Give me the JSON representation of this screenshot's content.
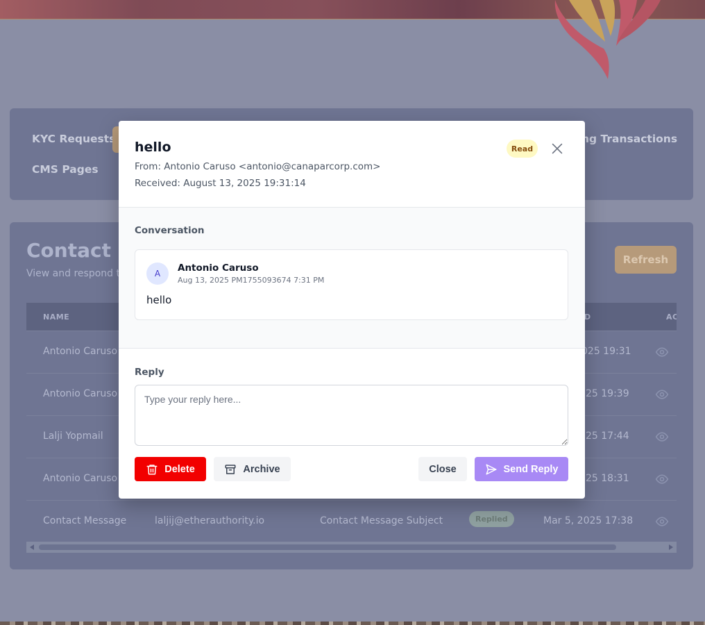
{
  "background": {
    "nav": {
      "items": [
        "KYC Requests",
        "CMS Pages",
        "ng Transactions"
      ]
    },
    "contact_messages": {
      "title_visible": "Contact M",
      "subtitle_visible": "View and respond to",
      "refresh_label": "Refresh",
      "table": {
        "headers": [
          "NAME",
          "D",
          "AC"
        ],
        "rows": [
          {
            "name": "Antonio Caruso",
            "email": "",
            "subject": "",
            "status": "",
            "date": "025 19:31"
          },
          {
            "name": "Antonio Caruso",
            "email": "",
            "subject": "",
            "status": "",
            "date": "25 19:39"
          },
          {
            "name": "Lalji Yopmail",
            "email": "",
            "subject": "",
            "status": "",
            "date": "25 17:44"
          },
          {
            "name": "Antonio Caruso",
            "email": "",
            "subject": "",
            "status": "",
            "date": "25 18:31"
          },
          {
            "name": "Contact Message",
            "email": "laljij@etherauthority.io",
            "subject": "Contact Message Subject",
            "status": "Replied",
            "date": "Mar 5, 2025 17:38"
          }
        ]
      }
    }
  },
  "modal": {
    "subject": "hello",
    "status_badge": "Read",
    "from": "From: Antonio Caruso <antonio@canaparcorp.com>",
    "received": "Received: August 13, 2025 19:31:14",
    "conversation_label": "Conversation",
    "message": {
      "avatar_letter": "A",
      "sender": "Antonio Caruso",
      "sent_at": "Aug 13, 2025 PM1755093674 7:31 PM",
      "body": "hello"
    },
    "reply_label": "Reply",
    "reply_value": "",
    "reply_placeholder": "Type your reply here...",
    "buttons": {
      "delete": "Delete",
      "archive": "Archive",
      "close": "Close",
      "send": "Send Reply"
    }
  },
  "colors": {
    "overlay_bg": "#8a8ea5",
    "delete": "#f20000",
    "send": "#a889f5",
    "badge_read_bg": "#fef9c3",
    "badge_read_text": "#854d0e"
  },
  "icons": [
    "flame-logo",
    "eye-icon",
    "close-icon",
    "trash-icon",
    "archive-icon",
    "send-icon"
  ]
}
